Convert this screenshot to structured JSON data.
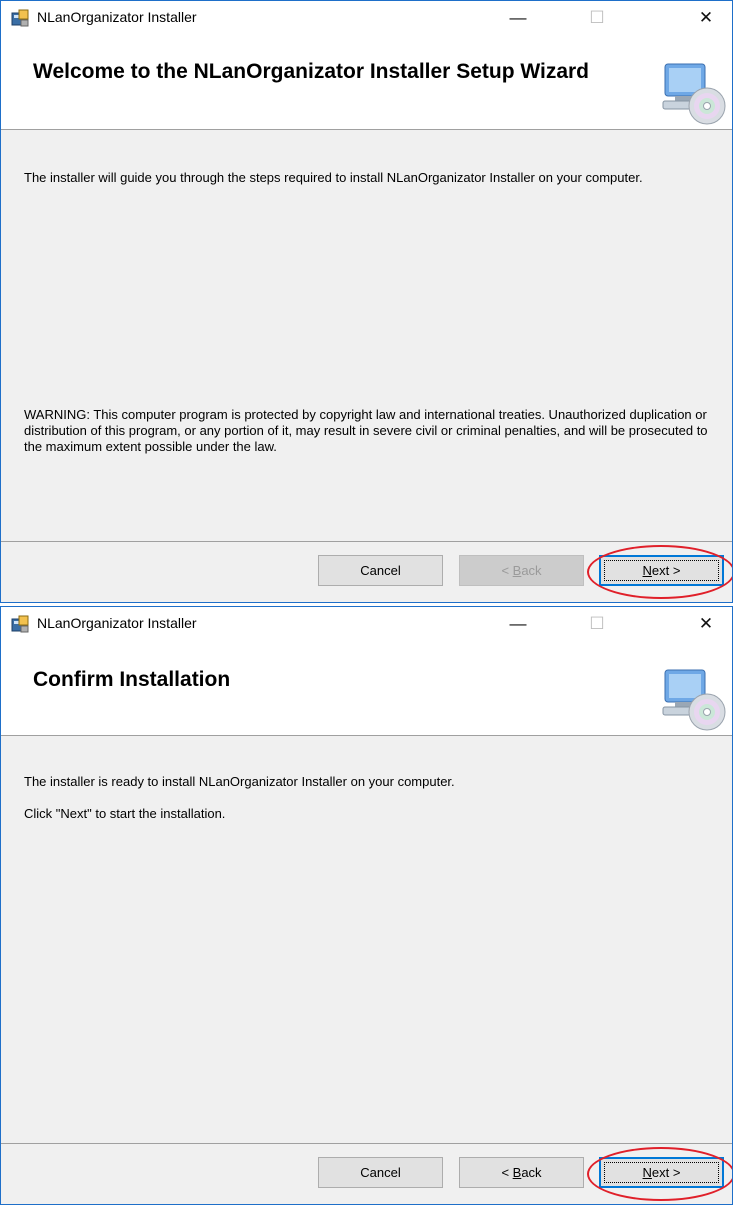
{
  "windows": [
    {
      "title": "NLanOrganizator Installer",
      "controls": {
        "minimize": "—",
        "maximize": "☐",
        "close": "✕"
      },
      "heading": "Welcome to the NLanOrganizator Installer Setup Wizard",
      "intro": "The installer will guide you through the steps required to install NLanOrganizator Installer on your computer.",
      "warning": "WARNING: This computer program is protected by copyright law and international treaties. Unauthorized duplication or distribution of this program, or any portion of it, may result in severe civil or criminal penalties, and will be prosecuted to the maximum extent possible under the law.",
      "buttons": {
        "cancel": "Cancel",
        "back_prefix": "< ",
        "back_key": "B",
        "back_rest": "ack",
        "next_key": "N",
        "next_rest": "ext >"
      }
    },
    {
      "title": "NLanOrganizator Installer",
      "controls": {
        "minimize": "—",
        "maximize": "☐",
        "close": "✕"
      },
      "heading": "Confirm Installation",
      "line1": "The installer is ready to install NLanOrganizator Installer on your computer.",
      "line2": "Click \"Next\" to start the installation.",
      "buttons": {
        "cancel": "Cancel",
        "back_prefix": "< ",
        "back_key": "B",
        "back_rest": "ack",
        "next_key": "N",
        "next_rest": "ext >"
      }
    }
  ],
  "colors": {
    "highlight": "#e0202a",
    "window_border": "#1e6fc9",
    "default_button_border": "#0078d7"
  }
}
